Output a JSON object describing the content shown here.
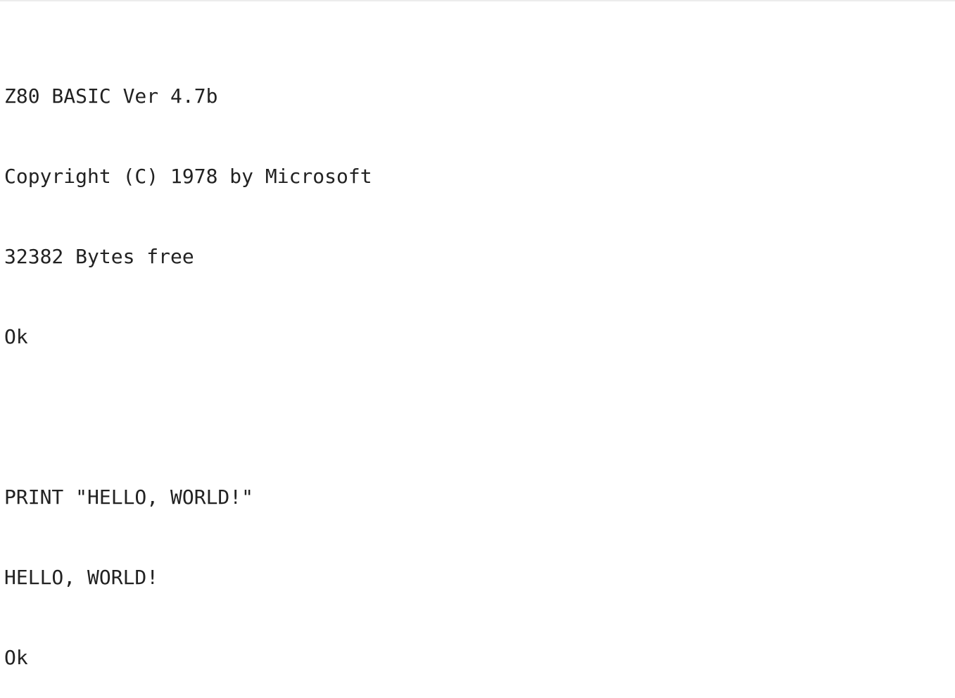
{
  "terminal": {
    "lines": [
      "Z80 BASIC Ver 4.7b",
      "Copyright (C) 1978 by Microsoft",
      "32382 Bytes free",
      "Ok",
      "",
      "PRINT \"HELLO, WORLD!\"",
      "HELLO, WORLD!",
      "Ok"
    ]
  }
}
